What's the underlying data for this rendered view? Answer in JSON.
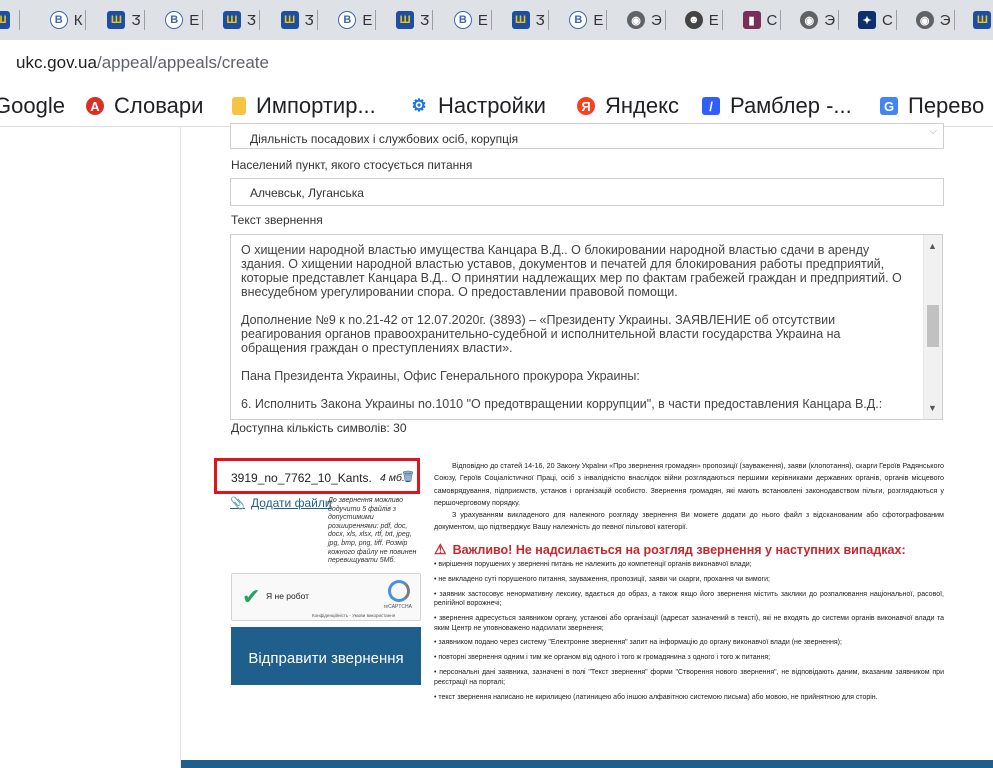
{
  "browser": {
    "tabs": [
      {
        "icon": "trident-icon",
        "letter": ""
      },
      {
        "icon": "shield-icon",
        "letter": "К"
      },
      {
        "icon": "trident-icon",
        "letter": "Ӡ"
      },
      {
        "icon": "shield-icon",
        "letter": "Е"
      },
      {
        "icon": "trident-icon",
        "letter": "Ӡ"
      },
      {
        "icon": "trident-icon",
        "letter": "Ӡ"
      },
      {
        "icon": "shield-icon",
        "letter": "Е"
      },
      {
        "icon": "trident-icon",
        "letter": "Ӡ"
      },
      {
        "icon": "shield-icon",
        "letter": "Е"
      },
      {
        "icon": "trident-icon",
        "letter": "Ӡ"
      },
      {
        "icon": "shield-icon",
        "letter": "Е"
      },
      {
        "icon": "globe-icon",
        "letter": "Э"
      },
      {
        "icon": "face-icon",
        "letter": "Е"
      },
      {
        "icon": "book-icon",
        "letter": "С"
      },
      {
        "icon": "globe-icon",
        "letter": "Э"
      },
      {
        "icon": "eagle-icon",
        "letter": "С"
      },
      {
        "icon": "globe-icon",
        "letter": "Э"
      },
      {
        "icon": "trident-icon",
        "letter": ""
      }
    ],
    "url_host": "ukc.gov.ua",
    "url_path": "/appeal/appeals/create",
    "bookmarks": [
      "Google",
      "Словари",
      "Импортир...",
      "Настройки",
      "Яндекс",
      "Рамблер -...",
      "Перево"
    ]
  },
  "form": {
    "category_value": "Діяльність посадових і службових осіб, корупція",
    "locality_label": "Населений пункт, якого стосується питання",
    "locality_value": "Алчевськ, Луганська",
    "text_label": "Текст звернення",
    "text_paragraphs": [
      "  О хищении народной властью имущества Канцара В.Д.. О блокировании народной властью сдачи в аренду здания. О хищении народной властью уставов, документов и печатей для блокирования работы предприятий, которые представлет Канцара В.Д.. О принятии надлежащих мер по фактам грабежей граждан и предприятий. О внесудебном урегулировании спора. О предоставлении правовой помощи.",
      "Дополнение №9 к no.21-42 от 12.07.2020г. (3893) – «Президенту Украины. ЗАЯВЛЕНИЕ об отсутствии реагирования органов правоохранительно-судебной и исполнительной власти государства Украина на обращения граждан о преступлениях власти».",
      "Пана Президента Украины, Офис Генерального прокурора Украины:",
      "6. Исполнить Закона Украины no.1010 \"О предотвращении коррупции\", в части предоставления Канцара В.Д.:"
    ],
    "symbols_left": "Доступна кількість символів: 30",
    "file_name": "3919_no_7762_10_Kants...",
    "file_size": "4 мб.",
    "add_file_label": "Додати файли",
    "file_hint": "До звернення можливо додучити 5 файлів з допустимими розширеннями: pdf, doc, docx, xls, xlsx, rtf, txt, jpeg, jpg, bmp, png, tiff. Розмір кожного файлу не повинен перевищувати 5Мб.",
    "captcha_label": "Я не робот",
    "captcha_brand": "reCAPTCHA",
    "captcha_terms": "Конфіденційність - Умови використання",
    "submit_label": "Відправити звернення"
  },
  "info": {
    "para1": "Відповідно до статей 14-16, 20 Закону України «Про звернення громадян» пропозиції (зауваження), заяви (клопотання), скарги Героїв Радянського Союзу, Героїв Соціалістичної Праці, осіб з інвалідністю внаслідок війни розглядаються першими керівниками державних органів, органів місцевого самоврядування, підприємств, установ і організацій особисто. Звернення громадян, які мають встановлені законодавством пільги, розглядаються у першочерговому порядку.",
    "para2": "З урахуванням викладеного для належного розгляду звернення Ви можете додати до нього файл з відсканованим або сфотографованим документом, що підтверджує Вашу належність до певної пільгової категорії.",
    "warning_title": "Важливо! Не надсилається на розгляд звернення у наступних випадках:",
    "rules": [
      "• вирішення порушених у зверненні питань не належить до компетенції органів виконавчої влади;",
      "• не викладено суті порушеного питання, зауваження, пропозиції, заяви чи скарги, прохання чи вимоги;",
      "• заявник застосовує ненормативну лексику, вдається до образ, а також якщо його звернення містить заклики до розпалювання національної, расової, релігійної ворожнечі;",
      "• звернення адресується заявником органу, установі або організації (адресат зазначений в тексті), які не входять до системи органів виконавчої влади та яким Центр не уповноважено надсилати звернення;",
      "• заявником подано через систему \"Електронне звернення\" запит на інформацію до органу виконавчої влади (не звернення);",
      "• повторні звернення одним і тим же органом від одного і того ж громадянина з одного і того ж питання;",
      "• персональні дані заявника, зазначені в полі \"Текст звернення\" форми \"Створення нового звернення\", не відповідають даним, вказаним заявником при реєстрації на порталі;",
      "• текст звернення написано не кирилицею (латиницею або іншою алфавітною системою письма) або мовою, не прийнятною для сторін."
    ]
  },
  "colors": {
    "brand": "#1f5f8b",
    "warning": "#c6282d",
    "highlight": "#e0141c"
  }
}
